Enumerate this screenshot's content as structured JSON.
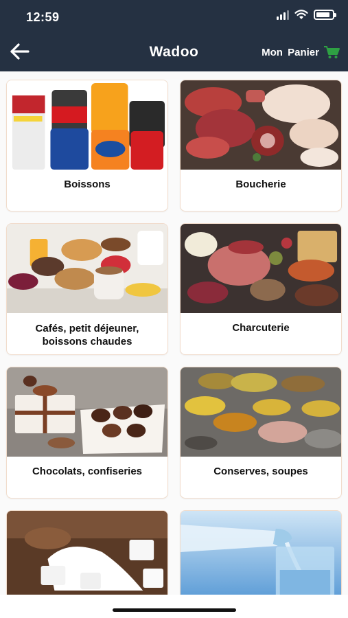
{
  "status_bar": {
    "time": "12:59",
    "battery_level": 0.85
  },
  "header": {
    "title": "Wadoo",
    "cart_label": "Mon Panier",
    "accent_color": "#2ea043"
  },
  "categories": [
    {
      "label": "Boissons"
    },
    {
      "label": "Boucherie"
    },
    {
      "label": "Cafés, petit déjeuner, boissons chaudes"
    },
    {
      "label": "Charcuterie"
    },
    {
      "label": "Chocolats, confiseries"
    },
    {
      "label": "Conserves, soupes"
    },
    {
      "label": ""
    },
    {
      "label": ""
    }
  ]
}
